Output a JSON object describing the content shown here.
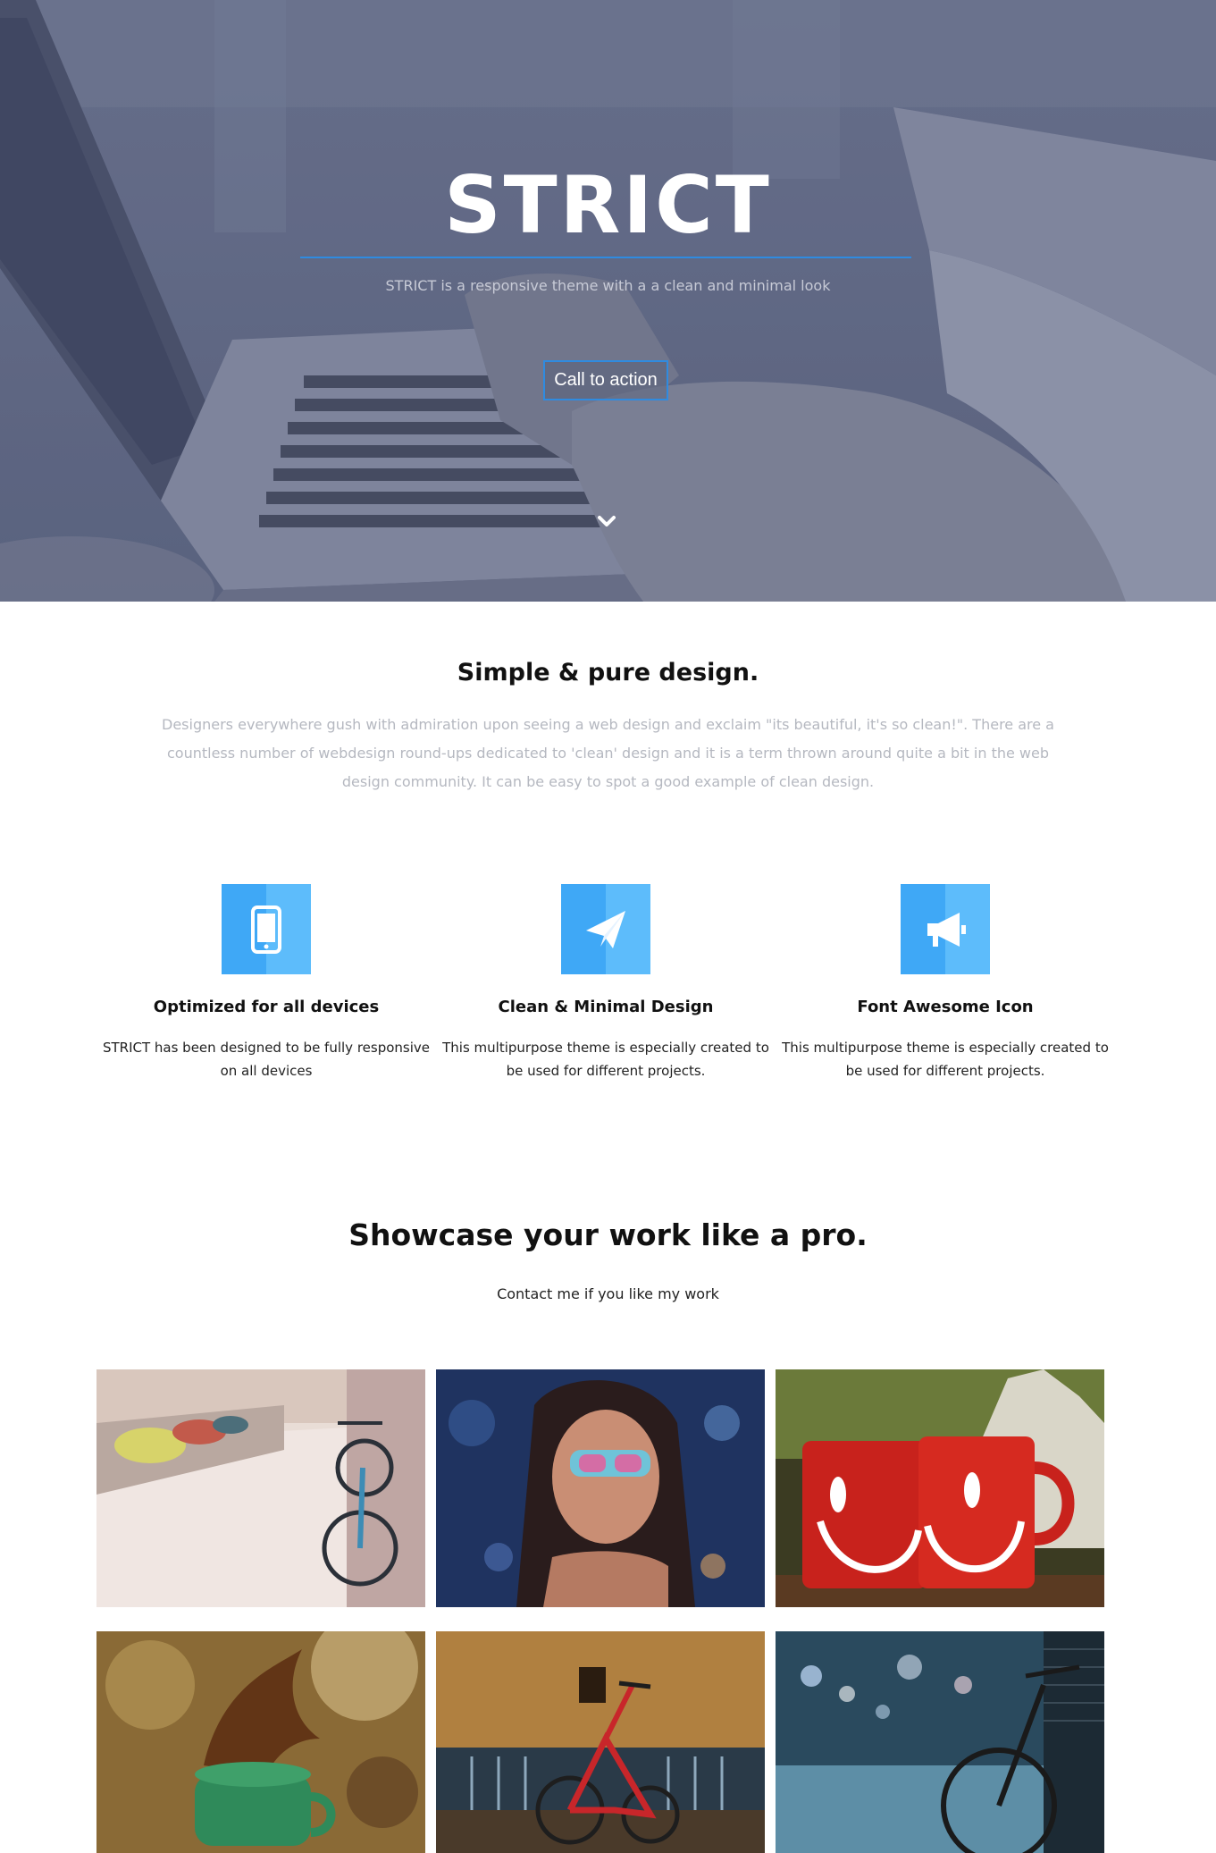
{
  "hero": {
    "title": "STRICT",
    "subtitle": "STRICT is a responsive theme with a a clean and minimal look",
    "cta_label": "Call to action",
    "accent_color": "#2f8be0",
    "scroll_icon": "chevron-down-icon"
  },
  "intro": {
    "title": "Simple & pure design.",
    "text": "Designers everywhere gush with admiration upon seeing a web design and exclaim \"its beautiful, it's so clean!\". There are a countless number of webdesign round-ups dedicated to 'clean' design and it is a term thrown around quite a bit in the web design community. It can be easy to spot a good example of clean design."
  },
  "features": [
    {
      "icon": "mobile-phone-icon",
      "title": "Optimized for all devices",
      "text": "STRICT has been designed to be fully responsive on all devices"
    },
    {
      "icon": "paper-plane-icon",
      "title": "Clean & Minimal Design",
      "text": "This multipurpose theme is especially created to be used for different projects."
    },
    {
      "icon": "megaphone-icon",
      "title": "Font Awesome Icon",
      "text": "This multipurpose theme is especially created to be used for different projects."
    }
  ],
  "showcase": {
    "title": "Showcase your work like a pro.",
    "subtitle": "Contact me if you like my work",
    "items": [
      {
        "subject": "bicycle-on-street-photo"
      },
      {
        "subject": "woman-with-sunglasses-photo"
      },
      {
        "subject": "red-smiley-mugs-photo"
      },
      {
        "subject": "green-cup-splash-photo"
      },
      {
        "subject": "red-bicycle-photo"
      },
      {
        "subject": "bicycle-night-street-photo"
      }
    ]
  },
  "colors": {
    "icon_blue": "#3fa8f6",
    "icon_blue_light": "#5dbcfb"
  }
}
